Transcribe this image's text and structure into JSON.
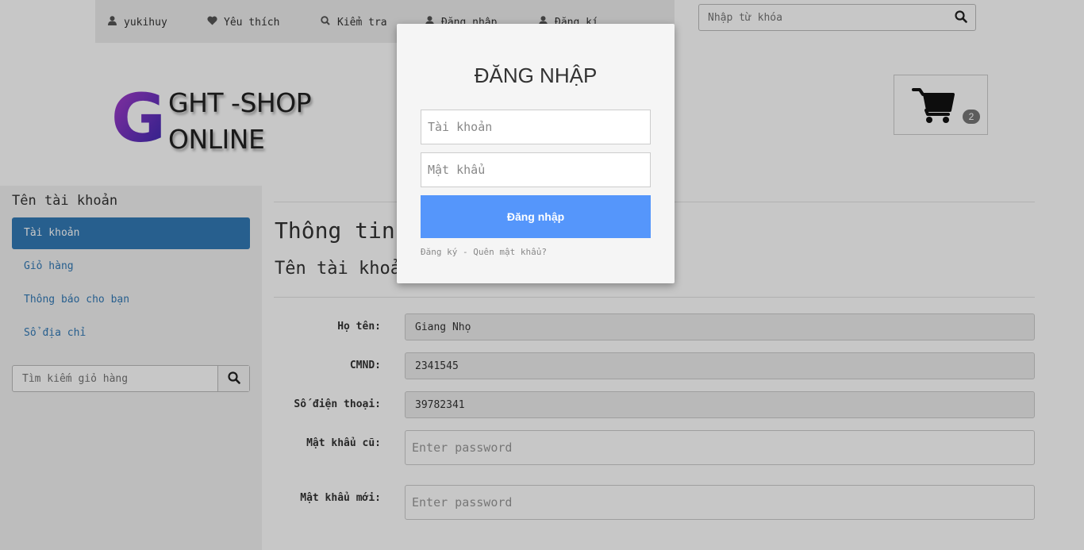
{
  "topnav": {
    "items": [
      {
        "label": "yukihuy",
        "icon": "user-icon"
      },
      {
        "label": "Yêu thích",
        "icon": "heart-icon"
      },
      {
        "label": "Kiểm tra",
        "icon": "search-icon"
      },
      {
        "label": "Đăng nhập",
        "icon": "user-icon"
      },
      {
        "label": "Đăng kí",
        "icon": "user-icon"
      }
    ],
    "search_placeholder": "Nhập từ khóa",
    "search_icon": "search-icon"
  },
  "header": {
    "logo_letter": "G",
    "logo_line1": "GHT -SHOP",
    "logo_line2": "ONLINE",
    "cart_icon": "cart-icon",
    "cart_count": "2"
  },
  "sidebar": {
    "title": "Tên tài khoản",
    "items": [
      {
        "label": "Tài khoản",
        "active": true
      },
      {
        "label": "Giỏ hàng",
        "active": false
      },
      {
        "label": "Thông báo cho bạn",
        "active": false
      },
      {
        "label": "Sổ địa chỉ",
        "active": false
      }
    ],
    "search_placeholder": "Tìm kiếm giỏ hàng",
    "search_icon": "search-icon"
  },
  "main": {
    "title": "Thông tin tài khoản",
    "subtitle": "Tên tài khoản",
    "fields": [
      {
        "label": "Họ tên:",
        "value": "Giang Nhọ"
      },
      {
        "label": "CMND:",
        "value": "2341545"
      },
      {
        "label": "Số điện thoại:",
        "value": "39782341"
      },
      {
        "label": "Mật khẩu cũ:",
        "placeholder": "Enter password"
      },
      {
        "label": "Mật khẩu mới:",
        "placeholder": "Enter password"
      }
    ]
  },
  "modal": {
    "title": "ĐĂNG NHẬP",
    "username_placeholder": "Tài khoản",
    "password_placeholder": "Mật khẩu",
    "login_label": "Đăng nhập",
    "register_link": "Đăng ký",
    "separator": "-",
    "forgot_link": "Quên mật khẩu?"
  },
  "colors": {
    "accent": "#337ab7",
    "login_button": "#5596fb",
    "logo_gradient_start": "#a33bc7",
    "logo_gradient_end": "#3a2fb8"
  }
}
